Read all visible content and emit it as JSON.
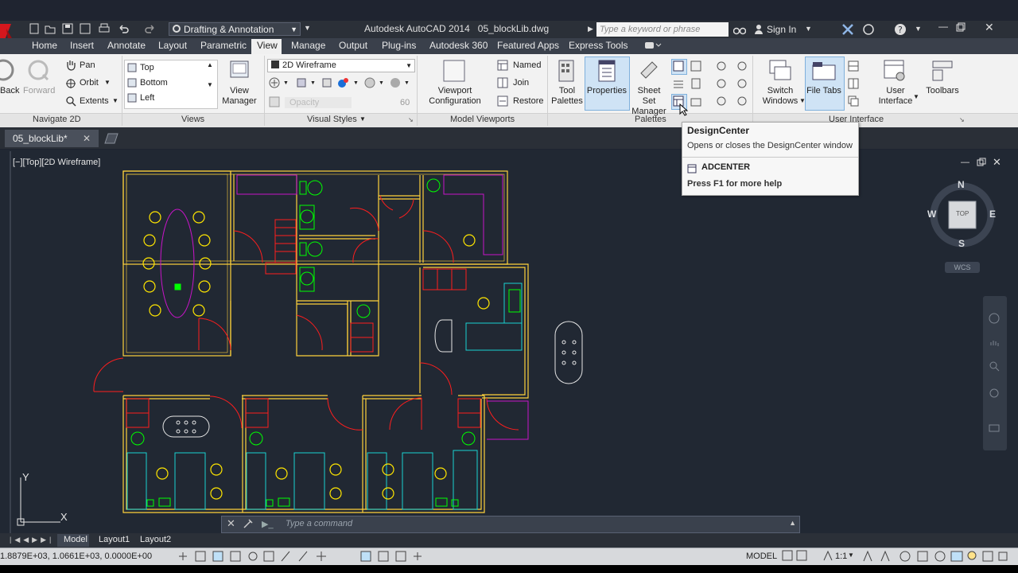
{
  "title_bar": {
    "workspace": "Drafting & Annotation",
    "app_title": "Autodesk AutoCAD 2014",
    "file_name": "05_blockLib.dwg",
    "search_placeholder": "Type a keyword or phrase",
    "sign_in": "Sign In"
  },
  "ribbon_tabs": [
    "Home",
    "Insert",
    "Annotate",
    "Layout",
    "Parametric",
    "View",
    "Manage",
    "Output",
    "Plug-ins",
    "Autodesk 360",
    "Featured Apps",
    "Express Tools"
  ],
  "active_tab": "View",
  "navigate": {
    "back": "Back",
    "forward": "Forward",
    "pan": "Pan",
    "orbit": "Orbit",
    "extents": "Extents",
    "title": "Navigate 2D"
  },
  "views": {
    "items": [
      "Top",
      "Bottom",
      "Left"
    ],
    "view_manager": "View Manager",
    "title": "Views"
  },
  "visual_styles": {
    "current": "2D Wireframe",
    "opacity_label": "Opacity",
    "opacity_value": "60",
    "title": "Visual Styles"
  },
  "model_viewports": {
    "config": "Viewport Configuration",
    "named": "Named",
    "join": "Join",
    "restore": "Restore",
    "title": "Model Viewports"
  },
  "palettes": {
    "tool_palettes": "Tool Palettes",
    "properties": "Properties",
    "sheet_set": "Sheet Set Manager",
    "title": "Palettes"
  },
  "user_interface": {
    "switch_windows": "Switch Windows",
    "file_tabs": "File Tabs",
    "user_interface": "User Interface",
    "toolbars": "Toolbars",
    "title": "User Interface"
  },
  "tooltip": {
    "title": "DesignCenter",
    "description": "Opens or closes the DesignCenter window",
    "command": "ADCENTER",
    "help": "Press F1 for more help"
  },
  "document_tab": "05_blockLib*",
  "viewport_label": "[−][Top][2D Wireframe]",
  "viewcube": {
    "n": "N",
    "s": "S",
    "e": "E",
    "w": "W",
    "face": "TOP",
    "wcs": "WCS"
  },
  "command_placeholder": "Type a command",
  "layout_tabs": [
    "Model",
    "Layout1",
    "Layout2"
  ],
  "status": {
    "coords": "1.8879E+03, 1.0661E+03, 0.0000E+00",
    "model": "MODEL",
    "scale": "1:1"
  },
  "ucs": {
    "x": "X",
    "y": "Y"
  },
  "colors": {
    "walls": "#ffd23c",
    "doors": "#ff1e1e",
    "furniture_yellow": "#ffe600",
    "plants": "#00ff00",
    "magenta": "#c814c8",
    "cyan": "#19d2d2",
    "white": "#e6e6e6"
  }
}
